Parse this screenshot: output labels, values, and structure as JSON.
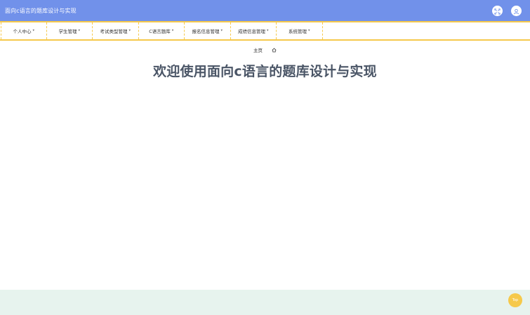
{
  "header": {
    "title": "面向c语言的题库设计与实现",
    "icons": [
      "fullscreen-icon",
      "user-icon"
    ]
  },
  "nav": {
    "items": [
      {
        "label": "个人中心"
      },
      {
        "label": "学生管理"
      },
      {
        "label": "考试类型管理"
      },
      {
        "label": "C语言题库"
      },
      {
        "label": "报名信息管理"
      },
      {
        "label": "成绩信息管理"
      },
      {
        "label": "系统管理"
      }
    ],
    "caret": "▾"
  },
  "breadcrumb": {
    "home_label": "主页",
    "icon": "home-icon"
  },
  "main": {
    "welcome_text": "欢迎使用面向c语言的题库设计与实现"
  },
  "footer": {
    "top_label": "Top"
  },
  "colors": {
    "header_bg": "#7191ea",
    "nav_border": "#f6c94b",
    "footer_bg": "#e7f3ee",
    "accent": "#f6c94b",
    "welcome_text": "#4a5566"
  }
}
